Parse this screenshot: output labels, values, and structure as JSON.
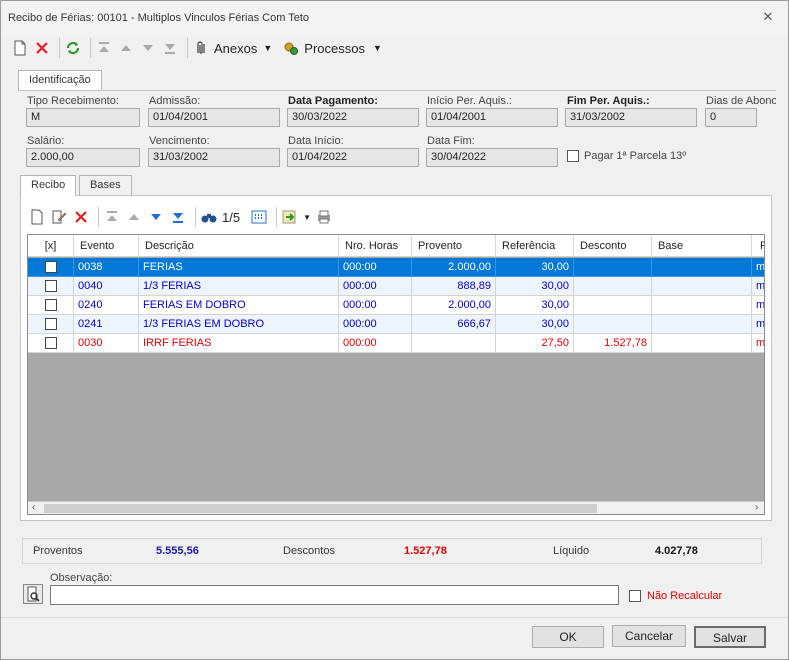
{
  "window": {
    "title": "Recibo de Férias: 00101 - Multiplos Vinculos Férias Com Teto"
  },
  "toolbar": {
    "anexos_label": "Anexos",
    "processos_label": "Processos"
  },
  "tabs_top": {
    "identificacao": "Identificação"
  },
  "form": {
    "tipo_recebimento": {
      "label": "Tipo Recebimento:",
      "value": "M"
    },
    "admissao": {
      "label": "Admissão:",
      "value": "01/04/2001"
    },
    "data_pagamento": {
      "label": "Data Pagamento:",
      "value": "30/03/2022"
    },
    "inicio_per_aquis": {
      "label": "Início Per. Aquis.:",
      "value": "01/04/2001"
    },
    "fim_per_aquis": {
      "label": "Fim Per. Aquis.:",
      "value": "31/03/2002"
    },
    "dias_abono": {
      "label": "Dias de Abono",
      "value": "0"
    },
    "salario": {
      "label": "Salário:",
      "value": "2.000,00"
    },
    "vencimento": {
      "label": "Vencimento:",
      "value": "31/03/2002"
    },
    "data_inicio": {
      "label": "Data Início:",
      "value": "01/04/2022"
    },
    "data_fim": {
      "label": "Data Fim:",
      "value": "30/04/2022"
    },
    "pagar_13": {
      "label": "Pagar 1ª Parcela 13º"
    }
  },
  "tabs_inner": {
    "recibo": "Recibo",
    "bases": "Bases"
  },
  "grid_toolbar": {
    "page": "1/5"
  },
  "grid": {
    "columns": [
      "[x]",
      "Evento",
      "Descrição",
      "Nro. Horas",
      "Provento",
      "Referência",
      "Desconto",
      "Base",
      "R"
    ],
    "rows": [
      {
        "evento": "0038",
        "descricao": "FERIAS",
        "horas": "000:00",
        "provento": "2.000,00",
        "referencia": "30,00",
        "desconto": "",
        "base": "",
        "r": "me"
      },
      {
        "evento": "0040",
        "descricao": "1/3 FERIAS",
        "horas": "000:00",
        "provento": "888,89",
        "referencia": "30,00",
        "desconto": "",
        "base": "",
        "r": "me"
      },
      {
        "evento": "0240",
        "descricao": "FERIAS EM DOBRO",
        "horas": "000:00",
        "provento": "2.000,00",
        "referencia": "30,00",
        "desconto": "",
        "base": "",
        "r": "me"
      },
      {
        "evento": "0241",
        "descricao": "1/3 FERIAS EM DOBRO",
        "horas": "000:00",
        "provento": "666,67",
        "referencia": "30,00",
        "desconto": "",
        "base": "",
        "r": "me"
      },
      {
        "evento": "0030",
        "descricao": "IRRF FERIAS",
        "horas": "000:00",
        "provento": "",
        "referencia": "27,50",
        "desconto": "1.527,78",
        "base": "",
        "r": "me"
      }
    ]
  },
  "totals": {
    "proventos_label": "Proventos",
    "proventos_value": "5.555,56",
    "descontos_label": "Descontos",
    "descontos_value": "1.527,78",
    "liquido_label": "Líquido",
    "liquido_value": "4.027,78"
  },
  "observacao": {
    "label": "Observação:",
    "value": ""
  },
  "nao_recalcular": {
    "label": "Não Recalcular"
  },
  "buttons": {
    "ok": "OK",
    "cancelar": "Cancelar",
    "salvar": "Salvar"
  },
  "colors": {
    "selected_row": "#0078d7",
    "blue_text": "#0000c8",
    "red_text": "#e00000",
    "alt_row": "#eef4fb"
  }
}
